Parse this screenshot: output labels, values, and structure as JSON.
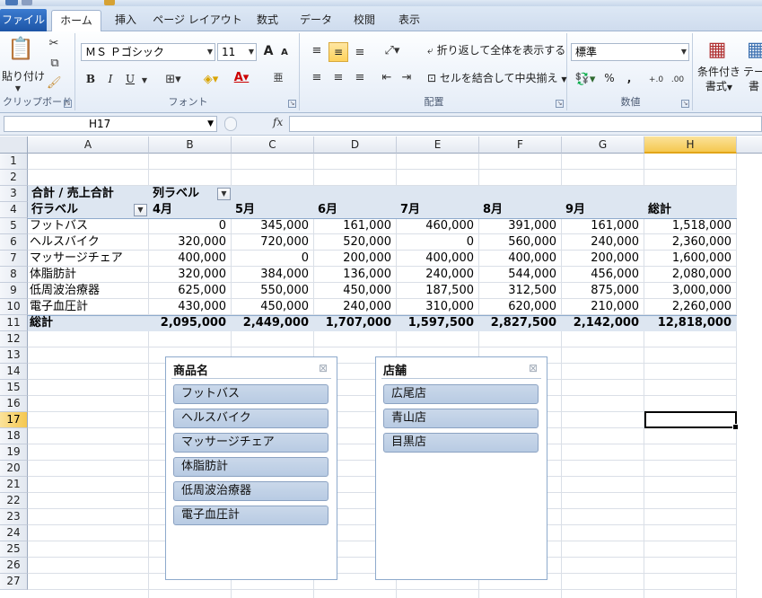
{
  "ribbon": {
    "tabs": [
      "ファイル",
      "ホーム",
      "挿入",
      "ページ レイアウト",
      "数式",
      "データ",
      "校閲",
      "表示"
    ],
    "active_tab": "ホーム",
    "clipboard": {
      "paste": "貼り付け",
      "label": "クリップボード"
    },
    "font": {
      "name": "ＭＳ Ｐゴシック",
      "size": "11",
      "bold": "B",
      "italic": "I",
      "underline": "U",
      "grow": "A",
      "shrink": "A",
      "label": "フォント"
    },
    "alignment": {
      "wrap": "折り返して全体を表示する",
      "merge": "セルを結合して中央揃え",
      "label": "配置"
    },
    "number": {
      "format": "標準",
      "percent": "%",
      "comma": ",",
      "label": "数値"
    },
    "styles": {
      "conditional": "条件付き",
      "conditional2": "書式",
      "table": "テー",
      "table2": "書"
    }
  },
  "formula_bar": {
    "name_box": "H17",
    "fx": "fx",
    "value": ""
  },
  "columns": [
    "A",
    "B",
    "C",
    "D",
    "E",
    "F",
    "G",
    "H"
  ],
  "selected_column": "H",
  "rows": [
    "1",
    "2",
    "3",
    "4",
    "5",
    "6",
    "7",
    "8",
    "9",
    "10",
    "11",
    "12",
    "13",
    "14",
    "15",
    "16",
    "17",
    "18",
    "19",
    "20",
    "21",
    "22",
    "23",
    "24",
    "25",
    "26",
    "27"
  ],
  "selected_row": "17",
  "pivot": {
    "value_label": "合計 / 売上合計",
    "col_label": "列ラベル",
    "row_label": "行ラベル",
    "months": [
      "4月",
      "5月",
      "6月",
      "7月",
      "8月",
      "9月",
      "総計"
    ],
    "data": [
      {
        "name": "フットバス",
        "values": [
          "0",
          "345,000",
          "161,000",
          "460,000",
          "391,000",
          "161,000",
          "1,518,000"
        ]
      },
      {
        "name": "ヘルスバイク",
        "values": [
          "320,000",
          "720,000",
          "520,000",
          "0",
          "560,000",
          "240,000",
          "2,360,000"
        ]
      },
      {
        "name": "マッサージチェア",
        "values": [
          "400,000",
          "0",
          "200,000",
          "400,000",
          "400,000",
          "200,000",
          "1,600,000"
        ]
      },
      {
        "name": "体脂肪計",
        "values": [
          "320,000",
          "384,000",
          "136,000",
          "240,000",
          "544,000",
          "456,000",
          "2,080,000"
        ]
      },
      {
        "name": "低周波治療器",
        "values": [
          "625,000",
          "550,000",
          "450,000",
          "187,500",
          "312,500",
          "875,000",
          "3,000,000"
        ]
      },
      {
        "name": "電子血圧計",
        "values": [
          "430,000",
          "450,000",
          "240,000",
          "310,000",
          "620,000",
          "210,000",
          "2,260,000"
        ]
      }
    ],
    "total": {
      "name": "総計",
      "values": [
        "2,095,000",
        "2,449,000",
        "1,707,000",
        "1,597,500",
        "2,827,500",
        "2,142,000",
        "12,818,000"
      ]
    }
  },
  "slicers": [
    {
      "title": "商品名",
      "items": [
        "フットバス",
        "ヘルスバイク",
        "マッサージチェア",
        "体脂肪計",
        "低周波治療器",
        "電子血圧計"
      ]
    },
    {
      "title": "店舗",
      "items": [
        "広尾店",
        "青山店",
        "目黒店"
      ]
    }
  ]
}
